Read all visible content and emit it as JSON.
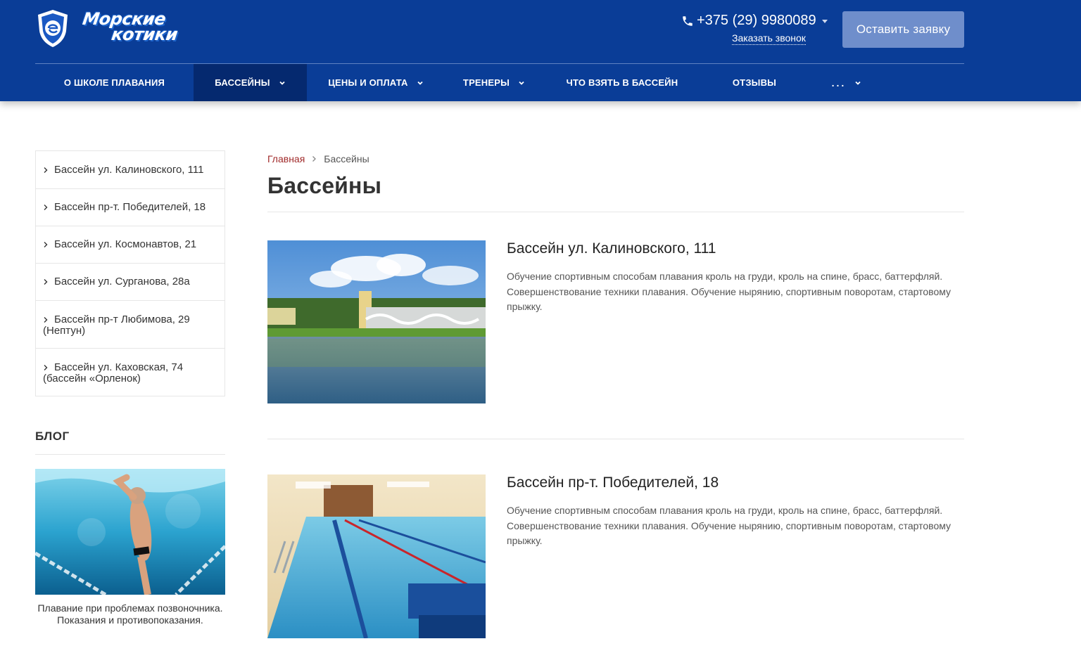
{
  "header": {
    "logo_text_line1": "Морские",
    "logo_text_line2": "котики",
    "phone": "+375 (29) 9980089",
    "callback_link": "Заказать звонок",
    "request_button": "Оставить заявку"
  },
  "nav": {
    "items": [
      {
        "label": "О ШКОЛЕ ПЛАВАНИЯ",
        "has_dropdown": false,
        "active": false
      },
      {
        "label": "БАССЕЙНЫ",
        "has_dropdown": true,
        "active": true
      },
      {
        "label": "ЦЕНЫ И ОПЛАТА",
        "has_dropdown": true,
        "active": false
      },
      {
        "label": "ТРЕНЕРЫ",
        "has_dropdown": true,
        "active": false
      },
      {
        "label": "ЧТО ВЗЯТЬ В БАССЕЙН",
        "has_dropdown": false,
        "active": false
      },
      {
        "label": "ОТЗЫВЫ",
        "has_dropdown": false,
        "active": false
      },
      {
        "label": "...",
        "has_dropdown": true,
        "active": false
      }
    ]
  },
  "sidebar": {
    "items": [
      {
        "label": "Бассейн ул. Калиновского, 111"
      },
      {
        "label": "Бассейн пр-т. Победителей, 18"
      },
      {
        "label": "Бассейн ул. Космонавтов, 21"
      },
      {
        "label": "Бассейн ул. Сурганова, 28а"
      },
      {
        "label": "Бассейн пр-т Любимова, 29 (Нептун)"
      },
      {
        "label": "Бассейн ул. Каховская, 74 (бассейн «Орленок)"
      }
    ],
    "blog_title": "БЛОГ",
    "blog_caption": "Плавание при проблемах позвоночника. Показания и противопоказания."
  },
  "breadcrumb": {
    "home": "Главная",
    "current": "Бассейны"
  },
  "page_title": "Бассейны",
  "pools": [
    {
      "title": "Бассейн ул. Калиновского, 111",
      "description": "Обучение спортивным способам плавания кроль на груди, кроль на спине, брасс, баттерфляй. Совершенствование техники плавания. Обучение нырянию, спортивным поворотам, стартовому прыжку."
    },
    {
      "title": "Бассейн пр-т. Победителей, 18",
      "description": "Обучение спортивным способам плавания кроль на груди, кроль на спине, брасс, баттерфляй. Совершенствование техники плавания. Обучение нырянию, спортивным поворотам, стартовому прыжку."
    }
  ],
  "colors": {
    "header_bg": "#0a3d97",
    "nav_active_bg": "#05296f",
    "button_bg": "#6f8ecb",
    "breadcrumb_link": "#a12b2b"
  }
}
